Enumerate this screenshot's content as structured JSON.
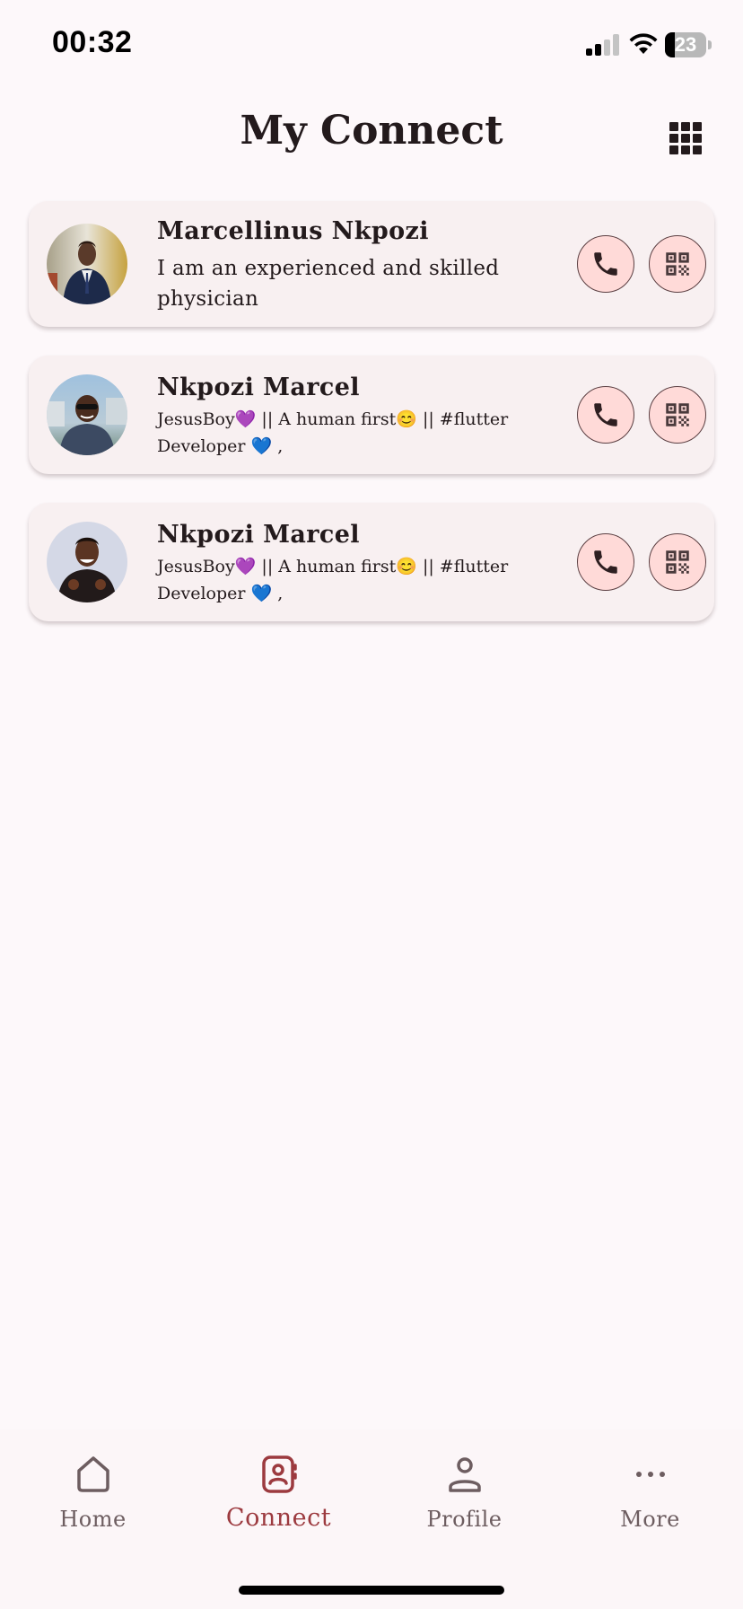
{
  "status_bar": {
    "time": "00:32",
    "battery_level": "23"
  },
  "header": {
    "title": "My Connect",
    "grid_icon": "grid-view-icon"
  },
  "contacts": [
    {
      "name": "Marcellinus Nkpozi",
      "bio": "I am an experienced and skilled physician",
      "call_icon": "phone-icon",
      "qr_icon": "qr-code-icon"
    },
    {
      "name": "Nkpozi Marcel",
      "bio": "JesusBoy💜 || A human first😊 || #flutter Developer 💙 ,",
      "call_icon": "phone-icon",
      "qr_icon": "qr-code-icon"
    },
    {
      "name": "Nkpozi Marcel",
      "bio": "JesusBoy💜 || A human first😊 || #flutter Developer 💙 ,",
      "call_icon": "phone-icon",
      "qr_icon": "qr-code-icon"
    }
  ],
  "bottom_nav": {
    "items": [
      {
        "label": "Home",
        "icon": "home-icon"
      },
      {
        "label": "Connect",
        "icon": "contact-book-icon",
        "active": true
      },
      {
        "label": "Profile",
        "icon": "person-icon"
      },
      {
        "label": "More",
        "icon": "more-dots-icon"
      }
    ]
  },
  "colors": {
    "background": "#fdf8fa",
    "card": "#f8f0f1",
    "button_fill": "#ffdad8",
    "accent": "#9c3a3f",
    "text": "#231a1c",
    "nav_inactive": "#6d5d60"
  }
}
